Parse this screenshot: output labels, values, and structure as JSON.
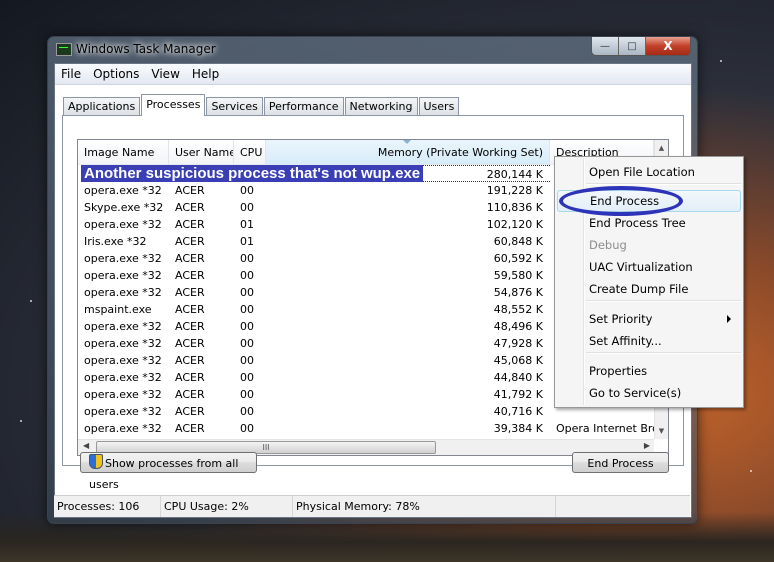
{
  "window": {
    "title": "Windows Task Manager",
    "controls": {
      "minimize": "—",
      "maximize": "□",
      "close": "X"
    }
  },
  "menubar": [
    "File",
    "Options",
    "View",
    "Help"
  ],
  "tabs": [
    {
      "label": "Applications",
      "active": false
    },
    {
      "label": "Processes",
      "active": true
    },
    {
      "label": "Services",
      "active": false
    },
    {
      "label": "Performance",
      "active": false
    },
    {
      "label": "Networking",
      "active": false
    },
    {
      "label": "Users",
      "active": false
    }
  ],
  "process_list": {
    "columns": [
      "Image Name",
      "User Name",
      "CPU",
      "Memory (Private Working Set)",
      "Description"
    ],
    "sorted_column": "Memory (Private Working Set)",
    "annotation_banner": "Another suspicious process that's not wup.exe",
    "rows": [
      {
        "name": "",
        "user": "",
        "cpu": "",
        "memory": "280,144 K",
        "description": "",
        "selected": true
      },
      {
        "name": "opera.exe *32",
        "user": "ACER",
        "cpu": "00",
        "memory": "191,228 K",
        "description": ""
      },
      {
        "name": "Skype.exe *32",
        "user": "ACER",
        "cpu": "00",
        "memory": "110,836 K",
        "description": ""
      },
      {
        "name": "opera.exe *32",
        "user": "ACER",
        "cpu": "01",
        "memory": "102,120 K",
        "description": ""
      },
      {
        "name": "Iris.exe *32",
        "user": "ACER",
        "cpu": "01",
        "memory": "60,848 K",
        "description": ""
      },
      {
        "name": "opera.exe *32",
        "user": "ACER",
        "cpu": "00",
        "memory": "60,592 K",
        "description": ""
      },
      {
        "name": "opera.exe *32",
        "user": "ACER",
        "cpu": "00",
        "memory": "59,580 K",
        "description": ""
      },
      {
        "name": "opera.exe *32",
        "user": "ACER",
        "cpu": "00",
        "memory": "54,876 K",
        "description": ""
      },
      {
        "name": "mspaint.exe",
        "user": "ACER",
        "cpu": "00",
        "memory": "48,552 K",
        "description": ""
      },
      {
        "name": "opera.exe *32",
        "user": "ACER",
        "cpu": "00",
        "memory": "48,496 K",
        "description": ""
      },
      {
        "name": "opera.exe *32",
        "user": "ACER",
        "cpu": "00",
        "memory": "47,928 K",
        "description": ""
      },
      {
        "name": "opera.exe *32",
        "user": "ACER",
        "cpu": "00",
        "memory": "45,068 K",
        "description": ""
      },
      {
        "name": "opera.exe *32",
        "user": "ACER",
        "cpu": "00",
        "memory": "44,840 K",
        "description": ""
      },
      {
        "name": "opera.exe *32",
        "user": "ACER",
        "cpu": "00",
        "memory": "41,792 K",
        "description": ""
      },
      {
        "name": "opera.exe *32",
        "user": "ACER",
        "cpu": "00",
        "memory": "40,716 K",
        "description": ""
      },
      {
        "name": "opera.exe *32",
        "user": "ACER",
        "cpu": "00",
        "memory": "39,384 K",
        "description": "Opera Internet Brov"
      }
    ],
    "hscroll_grip": "III"
  },
  "buttons": {
    "show_all_users": "Show processes from all users",
    "end_process": "End Process"
  },
  "status_bar": {
    "processes": "Processes: 106",
    "cpu_usage": "CPU Usage: 2%",
    "physical_memory": "Physical Memory: 78%"
  },
  "context_menu": {
    "items": [
      {
        "label": "Open File Location",
        "state": "normal"
      },
      {
        "label": "End Process",
        "state": "hover"
      },
      {
        "label": "End Process Tree",
        "state": "normal"
      },
      {
        "label": "Debug",
        "state": "disabled"
      },
      {
        "label": "UAC Virtualization",
        "state": "normal"
      },
      {
        "label": "Create Dump File",
        "state": "normal"
      },
      {
        "label": "Set Priority",
        "state": "normal",
        "submenu": true
      },
      {
        "label": "Set Affinity...",
        "state": "normal"
      },
      {
        "label": "Properties",
        "state": "normal"
      },
      {
        "label": "Go to Service(s)",
        "state": "normal"
      }
    ]
  },
  "colors": {
    "banner_bg": "#3a3fb5",
    "annotation_ellipse": "#2e34b8",
    "menu_hover": "#e2eef8"
  }
}
